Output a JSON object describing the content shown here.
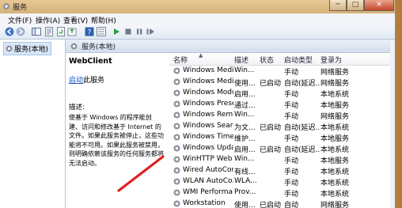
{
  "window": {
    "title": "服务",
    "btn_min": "─",
    "btn_max": "□",
    "btn_close": "✕"
  },
  "menubar": {
    "file": "文件(F)",
    "action": "操作(A)",
    "view": "查看(V)",
    "help": "帮助(H)"
  },
  "tree": {
    "item": "服务(本地)"
  },
  "main": {
    "header": "服务(本地)"
  },
  "detail": {
    "service_name": "WebClient",
    "start_link": "启动",
    "start_suffix": "此服务",
    "desc_label": "描述:",
    "desc_text": "使基于 Windows 的程序能创建、访问和修改基于 Internet 的文件。如果此服务被停止，这些功能将不可用。如果此服务被禁用，则明确依赖该服务的任何服务都将无法启动。"
  },
  "list": {
    "columns": [
      "名称",
      "描述",
      "状态",
      "启动类型",
      "登录为"
    ],
    "rows": [
      [
        "Windows Medi...",
        "Win...",
        "",
        "手动",
        "网络服务"
      ],
      [
        "Windows Medi...",
        "使用...",
        "已启动",
        "自动(延迟...",
        "网络服务"
      ],
      [
        "Windows Modu...",
        "启用...",
        "",
        "手动",
        "本地系统"
      ],
      [
        "Windows Prese...",
        "通过...",
        "",
        "手动",
        "本地服务"
      ],
      [
        "Windows Remo...",
        "Win...",
        "",
        "手动",
        "网络服务"
      ],
      [
        "Windows Search",
        "为文...",
        "已启动",
        "自动(延迟...",
        "本地系统"
      ],
      [
        "Windows Time",
        "维护...",
        "",
        "手动",
        "本地服务"
      ],
      [
        "Windows Update",
        "启用...",
        "已启动",
        "自动(延迟...",
        "本地系统"
      ],
      [
        "WinHTTP Web ...",
        "Win...",
        "",
        "手动",
        "本地服务"
      ],
      [
        "Wired AutoCon...",
        "有线...",
        "",
        "手动",
        "本地系统"
      ],
      [
        "WLAN AutoCo...",
        "WLA...",
        "",
        "手动",
        "本地系统"
      ],
      [
        "WMI Performa...",
        "Prov...",
        "",
        "手动",
        "本地系统"
      ],
      [
        "Workstation",
        "使用...",
        "已启动",
        "自动",
        "网络服务"
      ]
    ]
  },
  "colors": {
    "accent": "#1f55c4",
    "arrow": "#e02020"
  }
}
